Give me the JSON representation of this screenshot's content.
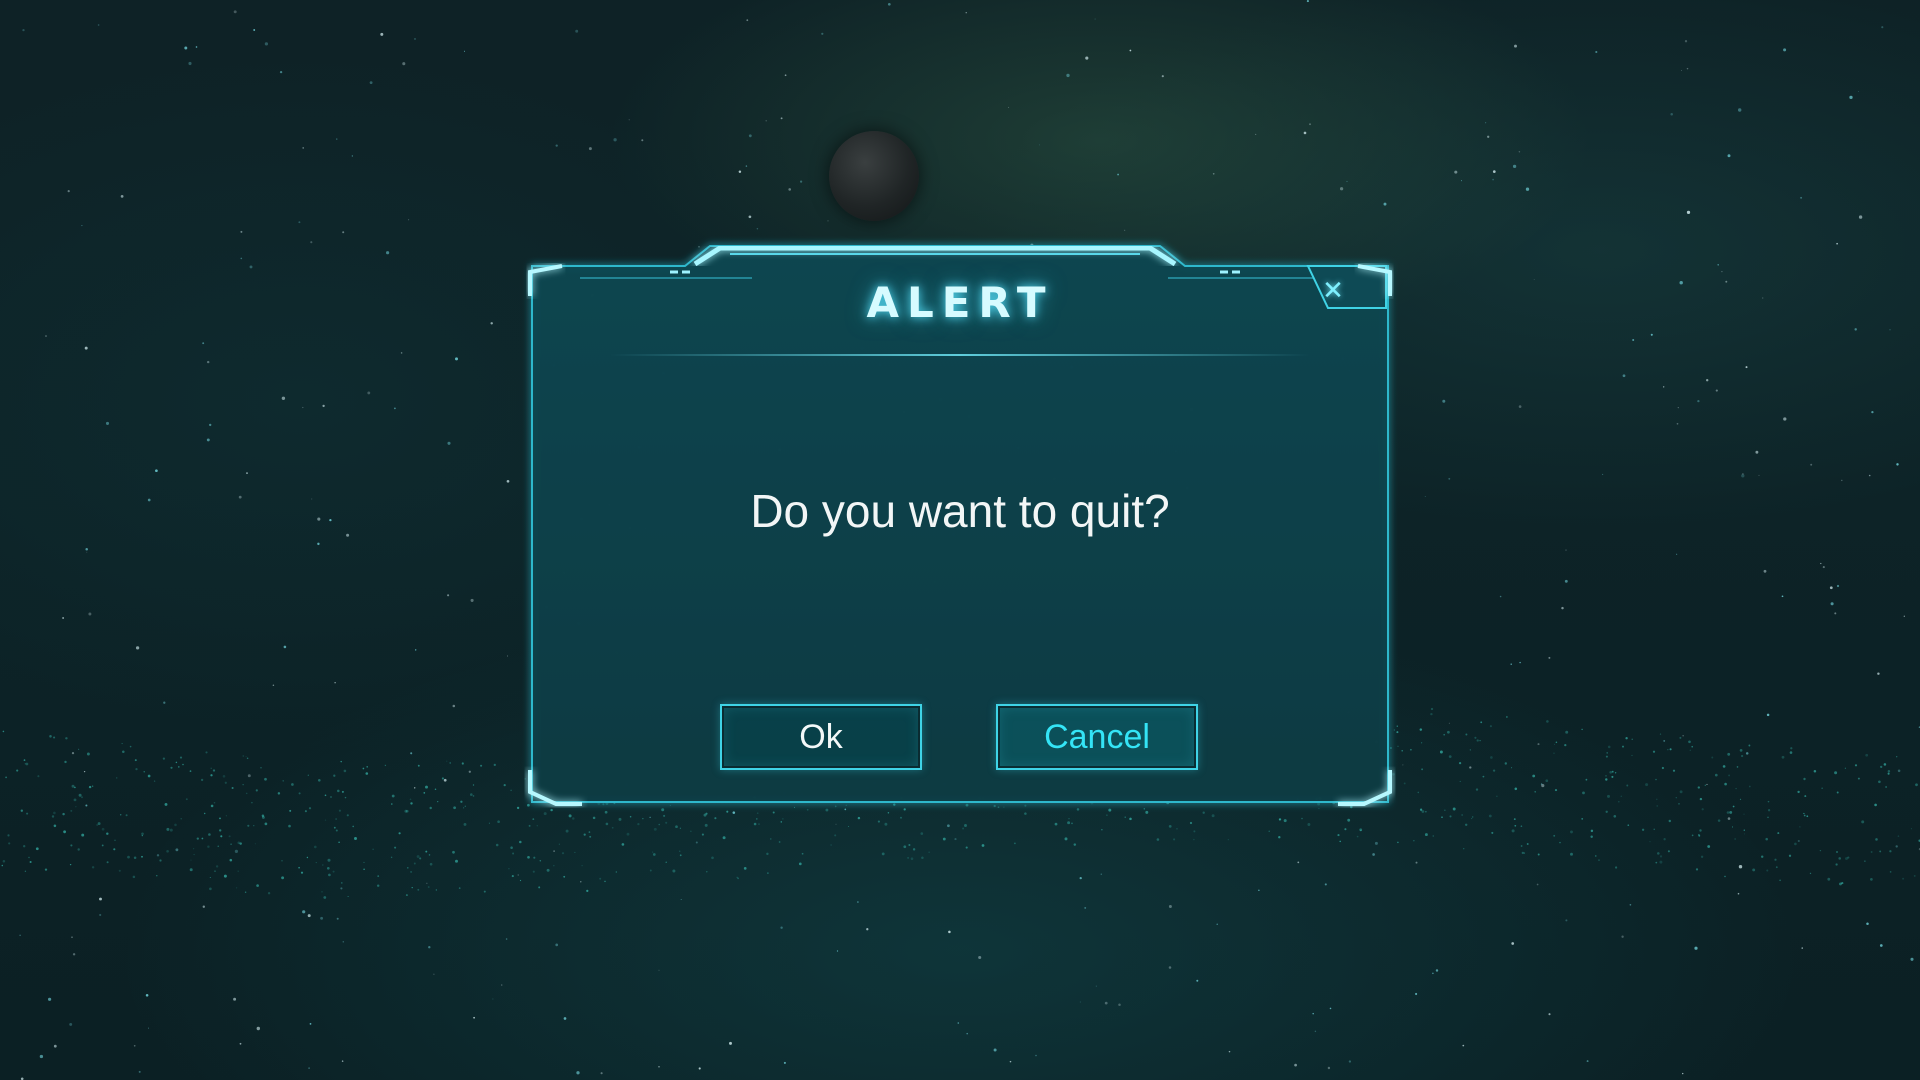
{
  "dialog": {
    "title": "ALERT",
    "close_icon": "✕",
    "message": "Do you want to quit?",
    "ok_label": "Ok",
    "cancel_label": "Cancel"
  },
  "icons": {
    "close": "close-icon"
  },
  "colors": {
    "accent": "#3fd3e6",
    "panel": "#0f4048",
    "title_glow": "#5ae6ff",
    "cancel_text": "#34e4f6"
  }
}
